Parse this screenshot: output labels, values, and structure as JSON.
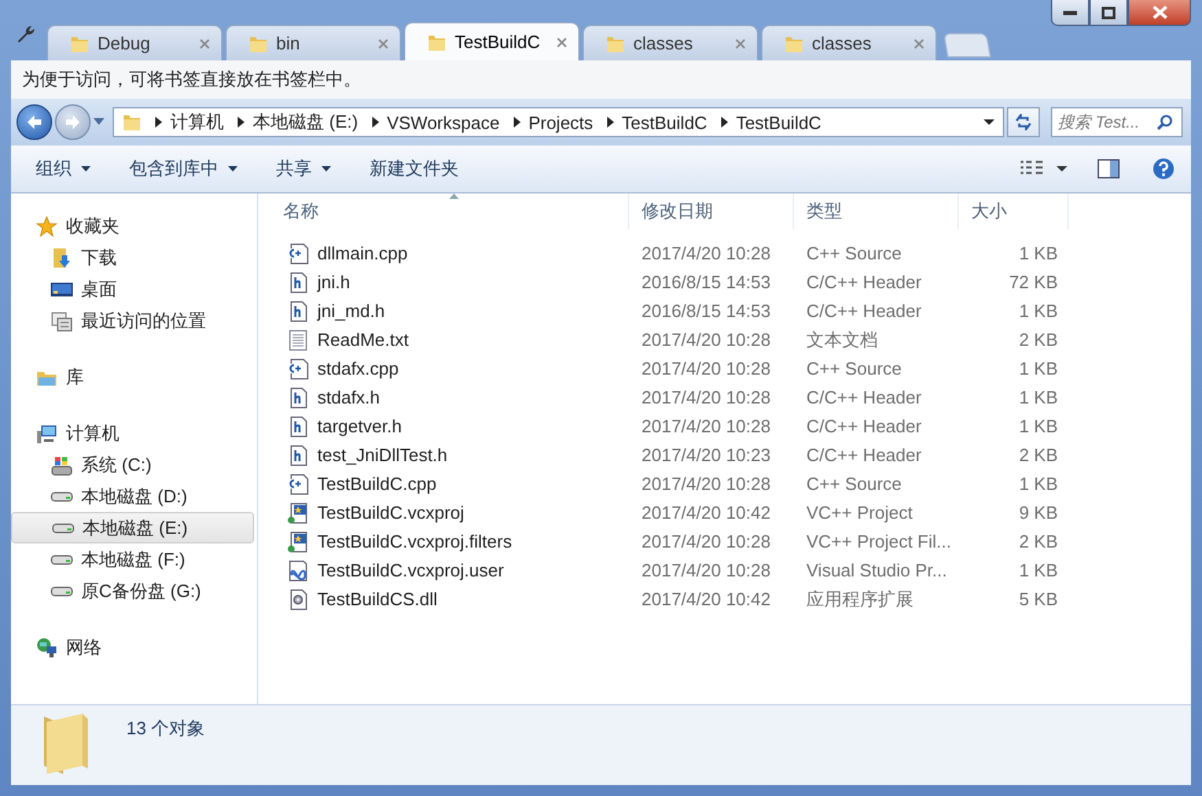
{
  "tabs": [
    {
      "label": "Debug",
      "selected": false
    },
    {
      "label": "bin",
      "selected": false
    },
    {
      "label": "TestBuildC",
      "selected": true
    },
    {
      "label": "classes",
      "selected": false
    },
    {
      "label": "classes",
      "selected": false
    }
  ],
  "bookmark_bar": {
    "message": "为便于访问，可将书签直接放在书签栏中。"
  },
  "address": {
    "crumbs": [
      "计算机",
      "本地磁盘 (E:)",
      "VSWorkspace",
      "Projects",
      "TestBuildC",
      "TestBuildC"
    ]
  },
  "search": {
    "placeholder": "搜索 Test..."
  },
  "toolbar": [
    {
      "label": "组织",
      "dropdown": true
    },
    {
      "label": "包含到库中",
      "dropdown": true
    },
    {
      "label": "共享",
      "dropdown": true
    },
    {
      "label": "新建文件夹",
      "dropdown": false
    }
  ],
  "sidebar": [
    {
      "label": "收藏夹",
      "kind": "star",
      "selected": false,
      "children": [
        {
          "label": "下载",
          "kind": "download",
          "selected": false
        },
        {
          "label": "桌面",
          "kind": "desktop",
          "selected": false
        },
        {
          "label": "最近访问的位置",
          "kind": "recent",
          "selected": false
        }
      ]
    },
    {
      "label": "库",
      "kind": "library",
      "selected": false
    },
    {
      "label": "计算机",
      "kind": "computer",
      "selected": false,
      "children": [
        {
          "label": "系统 (C:)",
          "kind": "system",
          "selected": false
        },
        {
          "label": "本地磁盘 (D:)",
          "kind": "drive",
          "selected": false
        },
        {
          "label": "本地磁盘 (E:)",
          "kind": "drive",
          "selected": true
        },
        {
          "label": "本地磁盘 (F:)",
          "kind": "drive",
          "selected": false
        },
        {
          "label": "原C备份盘 (G:)",
          "kind": "drive",
          "selected": false
        }
      ]
    },
    {
      "label": "网络",
      "kind": "network",
      "selected": false
    }
  ],
  "table": {
    "columns": [
      {
        "label": "名称",
        "sorted": true
      },
      {
        "label": "修改日期",
        "sorted": false
      },
      {
        "label": "类型",
        "sorted": false
      },
      {
        "label": "大小",
        "sorted": false
      }
    ],
    "rows": [
      {
        "kind": "cpp",
        "name": "dllmain.cpp",
        "date": "2017/4/20 10:28",
        "type": "C++ Source",
        "size": "1 KB"
      },
      {
        "kind": "h",
        "name": "jni.h",
        "date": "2016/8/15 14:53",
        "type": "C/C++ Header",
        "size": "72 KB"
      },
      {
        "kind": "h",
        "name": "jni_md.h",
        "date": "2016/8/15 14:53",
        "type": "C/C++ Header",
        "size": "1 KB"
      },
      {
        "kind": "txt",
        "name": "ReadMe.txt",
        "date": "2017/4/20 10:28",
        "type": "文本文档",
        "size": "2 KB"
      },
      {
        "kind": "cpp",
        "name": "stdafx.cpp",
        "date": "2017/4/20 10:28",
        "type": "C++ Source",
        "size": "1 KB"
      },
      {
        "kind": "h",
        "name": "stdafx.h",
        "date": "2017/4/20 10:28",
        "type": "C/C++ Header",
        "size": "1 KB"
      },
      {
        "kind": "h",
        "name": "targetver.h",
        "date": "2017/4/20 10:28",
        "type": "C/C++ Header",
        "size": "1 KB"
      },
      {
        "kind": "h",
        "name": "test_JniDllTest.h",
        "date": "2017/4/20 10:23",
        "type": "C/C++ Header",
        "size": "2 KB"
      },
      {
        "kind": "cpp",
        "name": "TestBuildC.cpp",
        "date": "2017/4/20 10:28",
        "type": "C++ Source",
        "size": "1 KB"
      },
      {
        "kind": "proj",
        "name": "TestBuildC.vcxproj",
        "date": "2017/4/20 10:42",
        "type": "VC++ Project",
        "size": "9 KB"
      },
      {
        "kind": "proj",
        "name": "TestBuildC.vcxproj.filters",
        "date": "2017/4/20 10:28",
        "type": "VC++ Project Fil...",
        "size": "2 KB"
      },
      {
        "kind": "user",
        "name": "TestBuildC.vcxproj.user",
        "date": "2017/4/20 10:28",
        "type": "Visual Studio Pr...",
        "size": "1 KB"
      },
      {
        "kind": "dll",
        "name": "TestBuildCS.dll",
        "date": "2017/4/20 10:42",
        "type": "应用程序扩展",
        "size": "5 KB"
      }
    ]
  },
  "status_bar": {
    "count": "13 个对象"
  }
}
